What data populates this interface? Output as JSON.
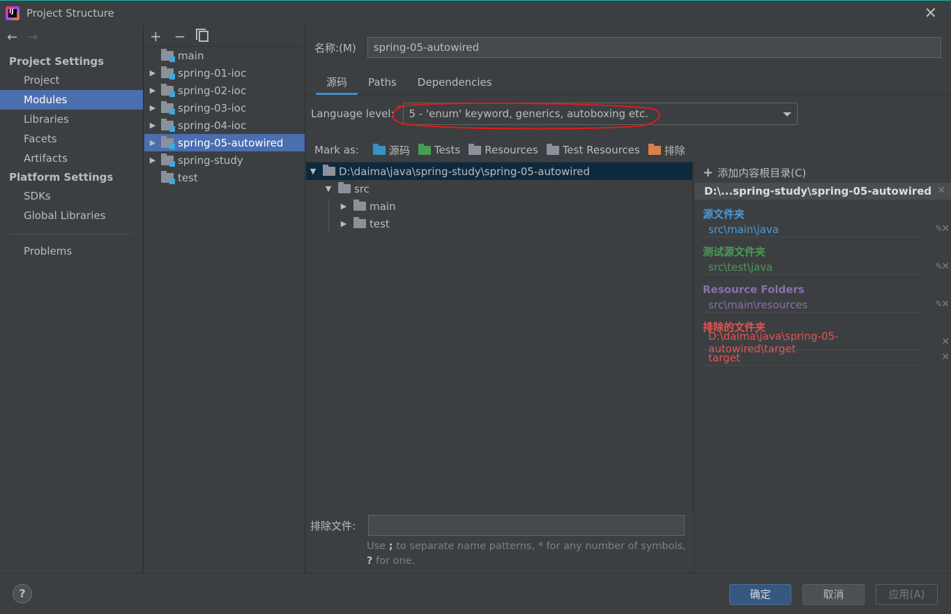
{
  "window": {
    "title": "Project Structure",
    "close_icon": "close-icon"
  },
  "nav": {
    "back_icon": "←",
    "forward_icon": "→",
    "project_settings_header": "Project Settings",
    "project_settings_items": [
      "Project",
      "Modules",
      "Libraries",
      "Facets",
      "Artifacts"
    ],
    "platform_settings_header": "Platform Settings",
    "platform_settings_items": [
      "SDKs",
      "Global Libraries"
    ],
    "problems": "Problems",
    "selected": "Modules"
  },
  "module_toolbar": {
    "add": "+",
    "remove": "−"
  },
  "modules": [
    {
      "name": "main",
      "expandable": false
    },
    {
      "name": "spring-01-ioc",
      "expandable": true
    },
    {
      "name": "spring-02-ioc",
      "expandable": true
    },
    {
      "name": "spring-03-ioc",
      "expandable": true
    },
    {
      "name": "spring-04-ioc",
      "expandable": true
    },
    {
      "name": "spring-05-autowired",
      "expandable": true,
      "selected": true
    },
    {
      "name": "spring-study",
      "expandable": true
    },
    {
      "name": "test",
      "expandable": false
    }
  ],
  "details": {
    "name_label": "名称:(M)",
    "name_value": "spring-05-autowired",
    "tabs": [
      "源码",
      "Paths",
      "Dependencies"
    ],
    "active_tab": "源码",
    "language_level_label": "Language level:",
    "language_level_value": "5 - 'enum' keyword, generics, autoboxing etc.",
    "annotation_color": "#e01b1b",
    "mark_as_label": "Mark as:",
    "mark_as": [
      "源码",
      "Tests",
      "Resources",
      "Test Resources",
      "排除"
    ],
    "tree": {
      "root": "D:\\daima\\java\\spring-study\\spring-05-autowired",
      "src": "src",
      "children": [
        "main",
        "test"
      ]
    },
    "exclude_label": "排除文件:",
    "exclude_value": "",
    "hint_part1": "Use ",
    "hint_semicolon": ";",
    "hint_part2": " to separate name patterns, * for any number of symbols, ",
    "hint_question": "?",
    "hint_part3": " for one."
  },
  "roots": {
    "add_label": "添加内容根目录(C)",
    "path": "D:\\...spring-study\\spring-05-autowired",
    "source_title": "源文件夹",
    "source_entries": [
      "src\\main\\java"
    ],
    "test_title": "测试源文件夹",
    "test_entries": [
      "src\\test\\java"
    ],
    "resource_title": "Resource Folders",
    "resource_entries": [
      "src\\main\\resources"
    ],
    "excluded_title": "排除的文件夹",
    "excluded_entries": [
      "D:\\daima\\java\\spring-05-autowired\\target",
      "target"
    ],
    "colors": {
      "source": "#4a9cdb",
      "test": "#499c54",
      "resource": "#8a6fae",
      "excluded": "#e05555"
    }
  },
  "footer": {
    "help": "?",
    "ok": "确定",
    "cancel": "取消",
    "apply": "应用(A)"
  }
}
